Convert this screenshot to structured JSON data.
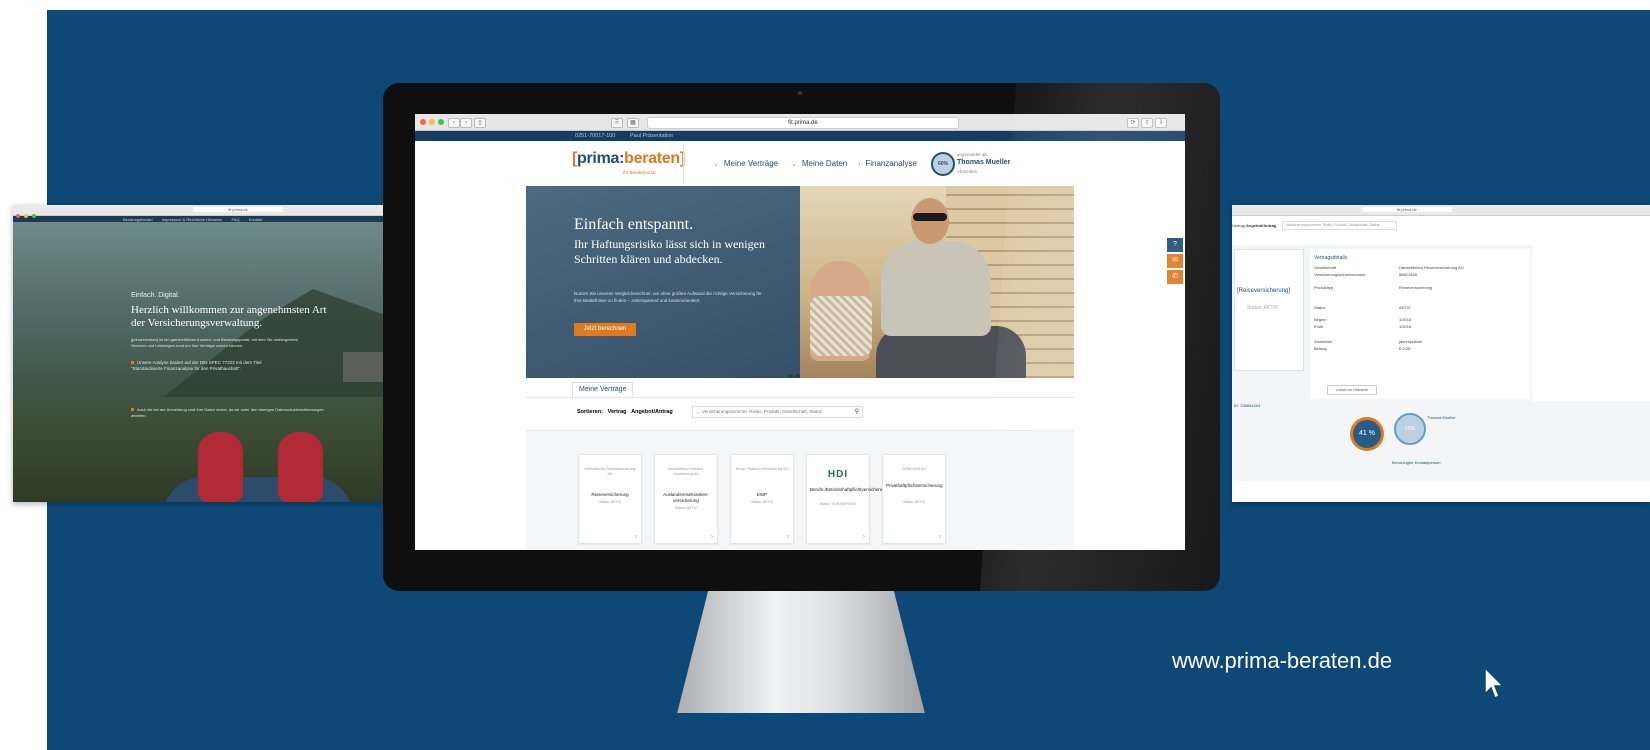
{
  "site": {
    "url": "www.prima-beraten.de"
  },
  "left_window": {
    "url": "fit.prima.de",
    "nav": [
      "Beratungsbedarf",
      "Impressum & Rechtliche Hinweise",
      "FAQ",
      "Kontakt"
    ],
    "tag": "Einfach. Digital.",
    "title": "Herzlich willkommen zur angenehmsten Art der Versicherungsverwaltung.",
    "intro": "[prima:beraten] ist ein ganzheitliches Kunden- und Beratungsportal, mit dem Sie umfangreiche Services und Leistungen rund um Ihre Verträge nutzen können.",
    "bullet": "Unsere Analyse basiert auf der DIN SPEC 77222 mit dem Titel \"Standardisierte Finanzanalyse für den Privathaushalt\".",
    "note": "Auch als bei der Anmeldung sind Ihre Daten sicher, da wir unter den strengen Datenschutzbestimmungen arbeiten."
  },
  "browser": {
    "url": "fit.prima.de",
    "phone": "0251-70017-100",
    "user_link": "Paul Präsentation"
  },
  "header": {
    "logo_bracket_open": "[",
    "logo_prima": "prima:",
    "logo_beraten": "beraten",
    "logo_bracket_close": "]",
    "tagline": "Ihr Beraterportal",
    "nav": [
      "Meine Verträge",
      "Meine Daten",
      "Finanzanalyse"
    ],
    "gauge": "60%",
    "user_label": "angemeldet als",
    "user_name": "Thomas Mueller",
    "user_role": "Abmelden"
  },
  "hero": {
    "title": "Einfach entspannt.",
    "subtitle": "Ihr Haftungsrisiko lässt sich in wenigen Schritten klären und abdecken.",
    "body": "Nutzen Sie unseren Vergleichsrechner, um ohne großen Aufwand die richtige Versicherung für Ihre Bedürfnisse zu finden – zeitersparend und kostenorientiert.",
    "button": "Jetzt berechnen"
  },
  "contracts": {
    "tab": "Meine Verträge",
    "sort_label": "Sortieren:",
    "sort_options": [
      "Vertrag",
      "Angebot/Antrag"
    ],
    "search_placeholder": "... Versicherungsnummer, Risiko, Produkt, Gesellschaft, Status",
    "cards": [
      {
        "provider": "HanseMerkur Reiseversicherung AG",
        "name": "Reiseversicherung",
        "status": "Status: AKTIV"
      },
      {
        "provider": "HanseMerkur Kranken-versicherung AG",
        "name": "Auslandsreisekranken-versicherung",
        "status": "Status: AKTIV"
      },
      {
        "provider": "Europ. Pflanzen-Versicherung AG",
        "name": "EWP",
        "status": "Status: AKTIV"
      },
      {
        "provider": "HDI",
        "name": "Berufs-/Betriebshaftpflichtversicherung",
        "status": "Status: VORANFRAGE"
      },
      {
        "provider": "DOMCURA AG",
        "name": "Privathaftpflichtversicherung",
        "status": "Status: AKTIV"
      }
    ]
  },
  "right_window": {
    "url": "fit.prima.de",
    "tabs": [
      "Vertrag",
      "Angebot/Antrag"
    ],
    "search_placeholder": "Versicherungsnummer, Risiko, Produkt, Gesellschaft, Status",
    "card_name": "[Reiseversicherung]",
    "card_status": "Status: AKTIV",
    "details_title": "Vertragsdetails",
    "details": [
      {
        "k": "Gesellschaft",
        "v": "HanseMerkur Reiseversicherung AG"
      },
      {
        "k": "Versicherungsscheinnummer",
        "v": "88821458"
      },
      {
        "k": "Produkttyp",
        "v": "Reiseversicherung"
      },
      {
        "k": "Status",
        "v": "AKTIV"
      },
      {
        "k": "Beginn",
        "v": "1/2016"
      },
      {
        "k": "Ende",
        "v": "1/2018"
      },
      {
        "k": "Zahlweise",
        "v": "jahresprämie"
      },
      {
        "k": "Beitrag",
        "v": "€ 0,00"
      }
    ],
    "back_button": "zurück zur Übersicht",
    "id": "ID: 338894263",
    "circle1": "41 %",
    "circle2": "60%",
    "advisor": "Thomas Mueller",
    "contact": "Bevorzugter Kontaktperson"
  }
}
